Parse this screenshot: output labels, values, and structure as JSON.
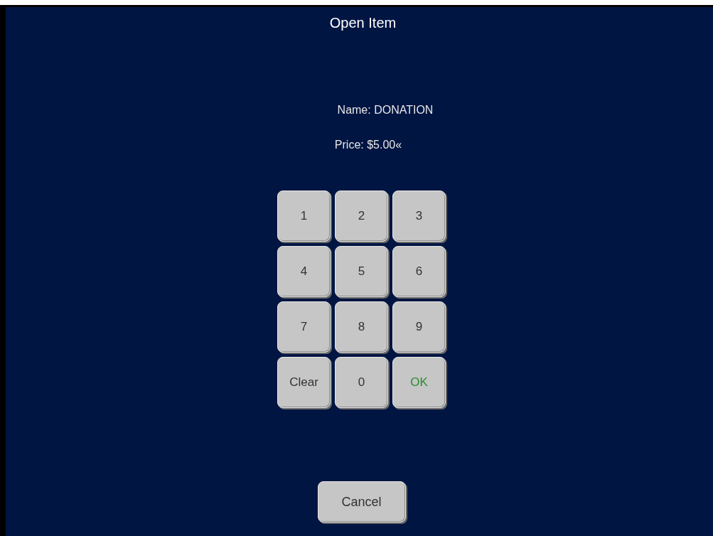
{
  "title": "Open Item",
  "name_line": "Name: DONATION",
  "price_line": "Price: $5.00«",
  "keypad": [
    {
      "label": "1",
      "kind": "digit"
    },
    {
      "label": "2",
      "kind": "digit"
    },
    {
      "label": "3",
      "kind": "digit"
    },
    {
      "label": "4",
      "kind": "digit"
    },
    {
      "label": "5",
      "kind": "digit"
    },
    {
      "label": "6",
      "kind": "digit"
    },
    {
      "label": "7",
      "kind": "digit"
    },
    {
      "label": "8",
      "kind": "digit"
    },
    {
      "label": "9",
      "kind": "digit"
    },
    {
      "label": "Clear",
      "kind": "clear"
    },
    {
      "label": "0",
      "kind": "digit"
    },
    {
      "label": "OK",
      "kind": "ok"
    }
  ],
  "cancel_button": "Cancel"
}
